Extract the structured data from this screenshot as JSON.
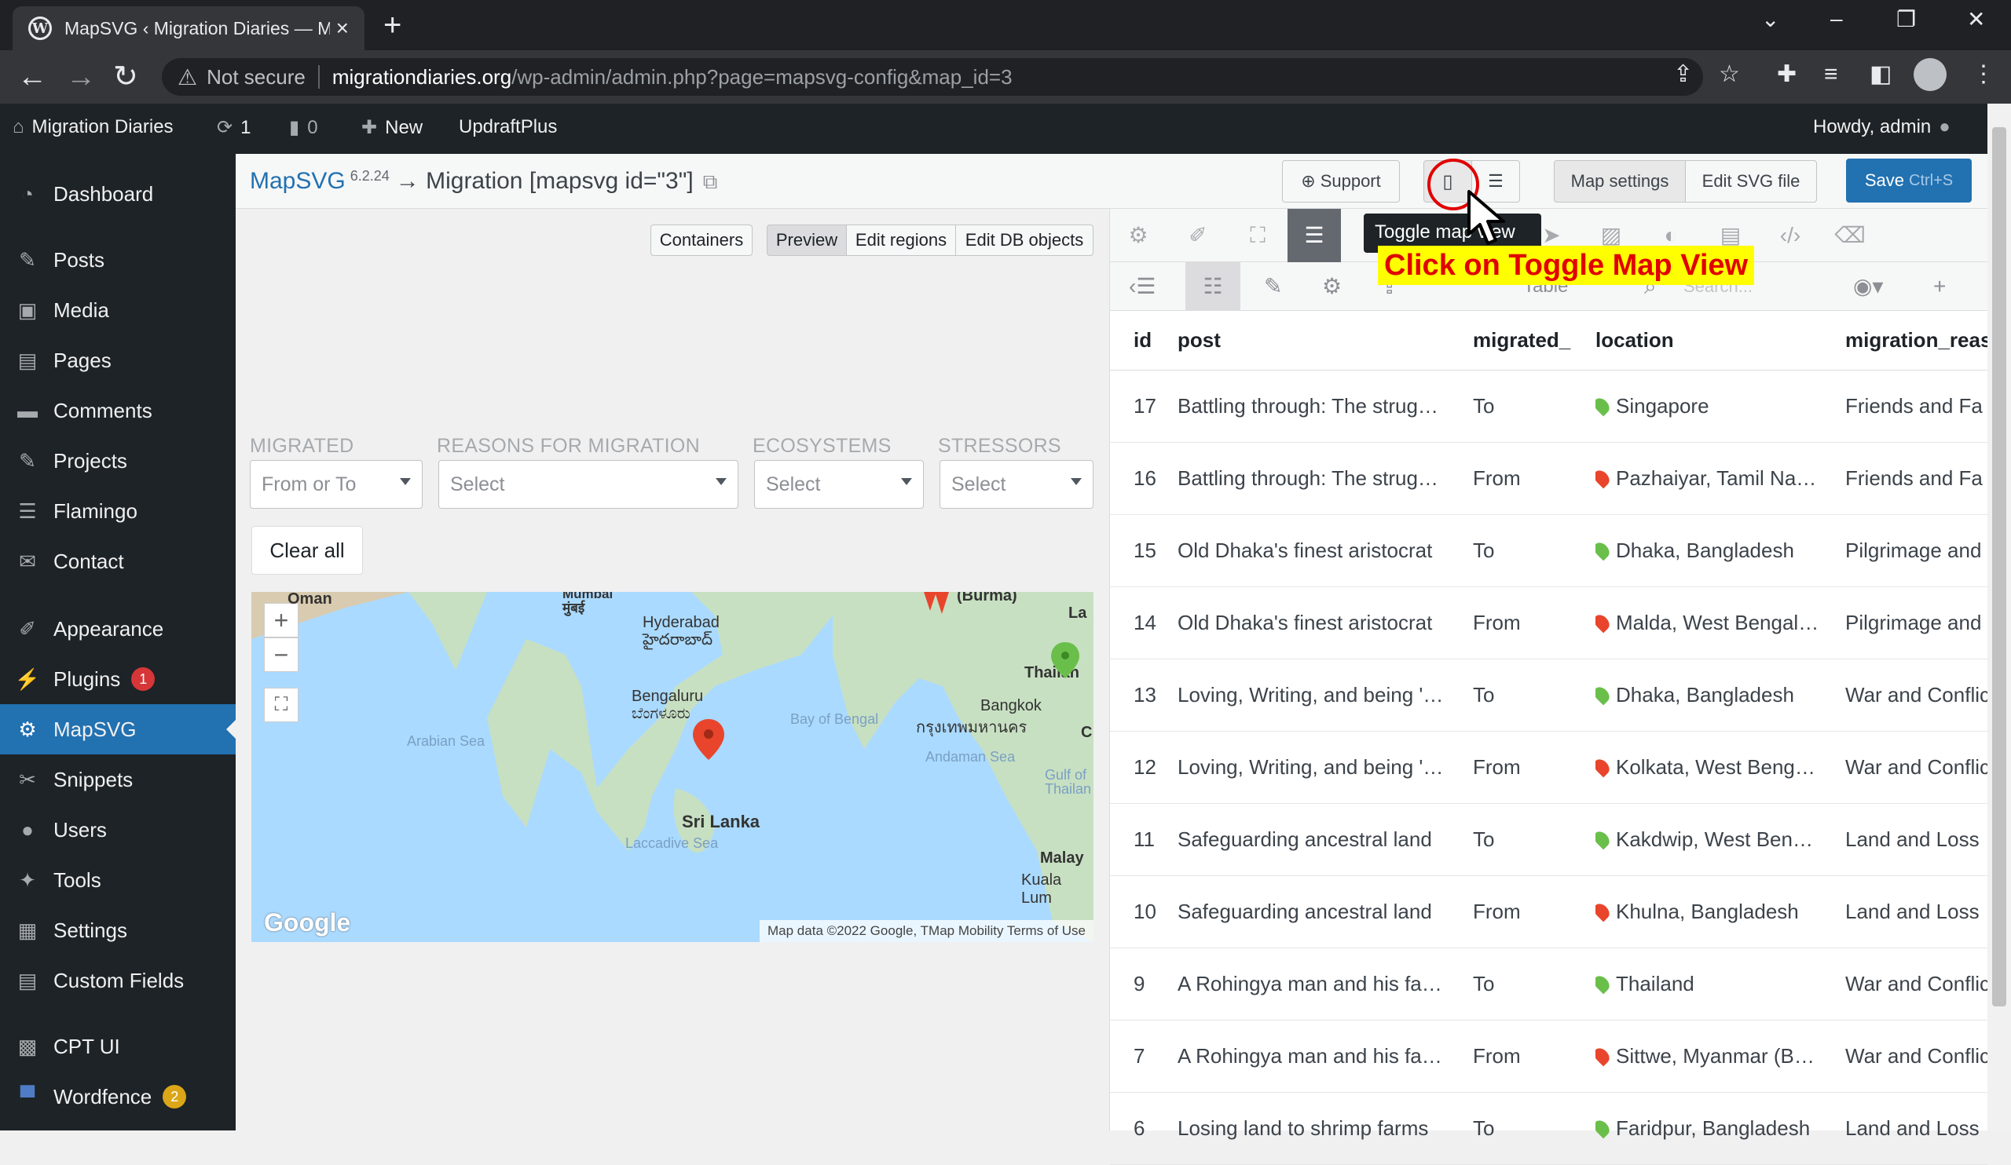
{
  "browser": {
    "tab_title": "MapSVG ‹ Migration Diaries — M",
    "new_tab": "+",
    "not_secure": "Not secure",
    "url_host": "migrationdiaries.org",
    "url_path": "/wp-admin/admin.php?page=mapsvg-config&map_id=3"
  },
  "admin_bar": {
    "site_name": "Migration Diaries",
    "updates": "1",
    "comments": "0",
    "new": "New",
    "updraft": "UpdraftPlus",
    "howdy": "Howdy, admin"
  },
  "sidebar": {
    "items": [
      {
        "label": "Dashboard",
        "icon": "dashboard-icon"
      },
      {
        "label": "Posts",
        "icon": "pin-icon"
      },
      {
        "label": "Media",
        "icon": "media-icon"
      },
      {
        "label": "Pages",
        "icon": "page-icon"
      },
      {
        "label": "Comments",
        "icon": "comment-icon"
      },
      {
        "label": "Projects",
        "icon": "pin-icon"
      },
      {
        "label": "Flamingo",
        "icon": "list-icon"
      },
      {
        "label": "Contact",
        "icon": "mail-icon"
      },
      {
        "label": "Appearance",
        "icon": "brush-icon"
      },
      {
        "label": "Plugins",
        "icon": "plugin-icon",
        "badge": "1"
      },
      {
        "label": "MapSVG",
        "icon": "gear-icon"
      },
      {
        "label": "Snippets",
        "icon": "scissors-icon"
      },
      {
        "label": "Users",
        "icon": "user-icon"
      },
      {
        "label": "Tools",
        "icon": "wrench-icon"
      },
      {
        "label": "Settings",
        "icon": "settings-icon"
      },
      {
        "label": "Custom Fields",
        "icon": "table-icon"
      },
      {
        "label": "CPT UI",
        "icon": "grid-icon"
      },
      {
        "label": "Wordfence",
        "icon": "wordfence-icon",
        "badge": "2"
      }
    ]
  },
  "header": {
    "brand": "MapSVG",
    "version": "6.2.24",
    "title": "→ Migration [mapsvg id=\"3\"]",
    "support": "Support",
    "map_settings": "Map settings",
    "edit_svg": "Edit SVG file",
    "save": "Save",
    "save_hint": "Ctrl+S"
  },
  "left": {
    "containers": "Containers",
    "preview": "Preview",
    "edit_regions": "Edit regions",
    "edit_db": "Edit DB objects",
    "filters": [
      {
        "label": "MIGRATED",
        "value": "From or To"
      },
      {
        "label": "REASONS FOR MIGRATION",
        "value": "Select"
      },
      {
        "label": "ECOSYSTEMS",
        "value": "Select"
      },
      {
        "label": "STRESSORS",
        "value": "Select"
      }
    ],
    "clear_all": "Clear all",
    "map": {
      "places": {
        "oman": "Oman",
        "mumbai": "Mumbai\nमुंबई",
        "hyderabad": "Hyderabad",
        "hyderabad_te": "హైదరాబాద్",
        "bengaluru": "Bengaluru",
        "bengaluru_kn": "ಬೆಂಗಳೂರು",
        "srilanka": "Sri Lanka",
        "burma": "(Burma)",
        "thailand": "Thailan",
        "bangkok": "Bangkok",
        "bangkok_th": "กรุงเทพมหานคร",
        "malay": "Malay",
        "kl": "Kuala Lum",
        "la": "La",
        "c": "C",
        "arabian": "Arabian Sea",
        "bay": "Bay of Bengal",
        "andaman": "Andaman Sea",
        "laccadive": "Laccadive Sea",
        "gulf": "Gulf of\nThailan"
      },
      "google": "Google",
      "footer": "Map data ©2022 Google, TMap Mobility   Terms of Use"
    }
  },
  "right": {
    "tooltip": "Toggle map view",
    "callout": "Click on Toggle Map View",
    "sub_table": "Table",
    "sub_search": "Search...",
    "columns": [
      "id",
      "post",
      "migrated_",
      "location",
      "migration_reas"
    ],
    "rows": [
      {
        "id": "17",
        "post": "Battling through: The strug…",
        "migrated": "To",
        "location": "Singapore",
        "reason": "Friends and Fa",
        "pin": "green"
      },
      {
        "id": "16",
        "post": "Battling through: The strug…",
        "migrated": "From",
        "location": "Pazhaiyar, Tamil Na…",
        "reason": "Friends and Fa",
        "pin": "red"
      },
      {
        "id": "15",
        "post": "Old Dhaka's finest aristocrat",
        "migrated": "To",
        "location": "Dhaka, Bangladesh",
        "reason": "Pilgrimage and",
        "pin": "green"
      },
      {
        "id": "14",
        "post": "Old Dhaka's finest aristocrat",
        "migrated": "From",
        "location": "Malda, West Bengal…",
        "reason": "Pilgrimage and",
        "pin": "red"
      },
      {
        "id": "13",
        "post": "Loving, Writing, and being '…",
        "migrated": "To",
        "location": "Dhaka, Bangladesh",
        "reason": "War and Conflic",
        "pin": "green"
      },
      {
        "id": "12",
        "post": "Loving, Writing, and being '…",
        "migrated": "From",
        "location": "Kolkata, West Beng…",
        "reason": "War and Conflic",
        "pin": "red"
      },
      {
        "id": "11",
        "post": "Safeguarding ancestral land",
        "migrated": "To",
        "location": "Kakdwip, West Ben…",
        "reason": "Land and Loss",
        "pin": "green"
      },
      {
        "id": "10",
        "post": "Safeguarding ancestral land",
        "migrated": "From",
        "location": "Khulna, Bangladesh",
        "reason": "Land and Loss",
        "pin": "red"
      },
      {
        "id": "9",
        "post": "A Rohingya man and his fa…",
        "migrated": "To",
        "location": "Thailand",
        "reason": "War and Conflic",
        "pin": "green"
      },
      {
        "id": "7",
        "post": "A Rohingya man and his fa…",
        "migrated": "From",
        "location": "Sittwe, Myanmar (B…",
        "reason": "War and Conflic",
        "pin": "red"
      },
      {
        "id": "6",
        "post": "Losing land to shrimp farms",
        "migrated": "To",
        "location": "Faridpur, Bangladesh",
        "reason": "Land and Loss",
        "pin": "green"
      }
    ]
  },
  "colors": {
    "wp_dark": "#1d2327",
    "wp_blue": "#2271b1",
    "pin_green": "#6abf4b",
    "pin_red": "#e8452c",
    "callout_bg": "#ffff00",
    "callout_fg": "#e00000"
  }
}
